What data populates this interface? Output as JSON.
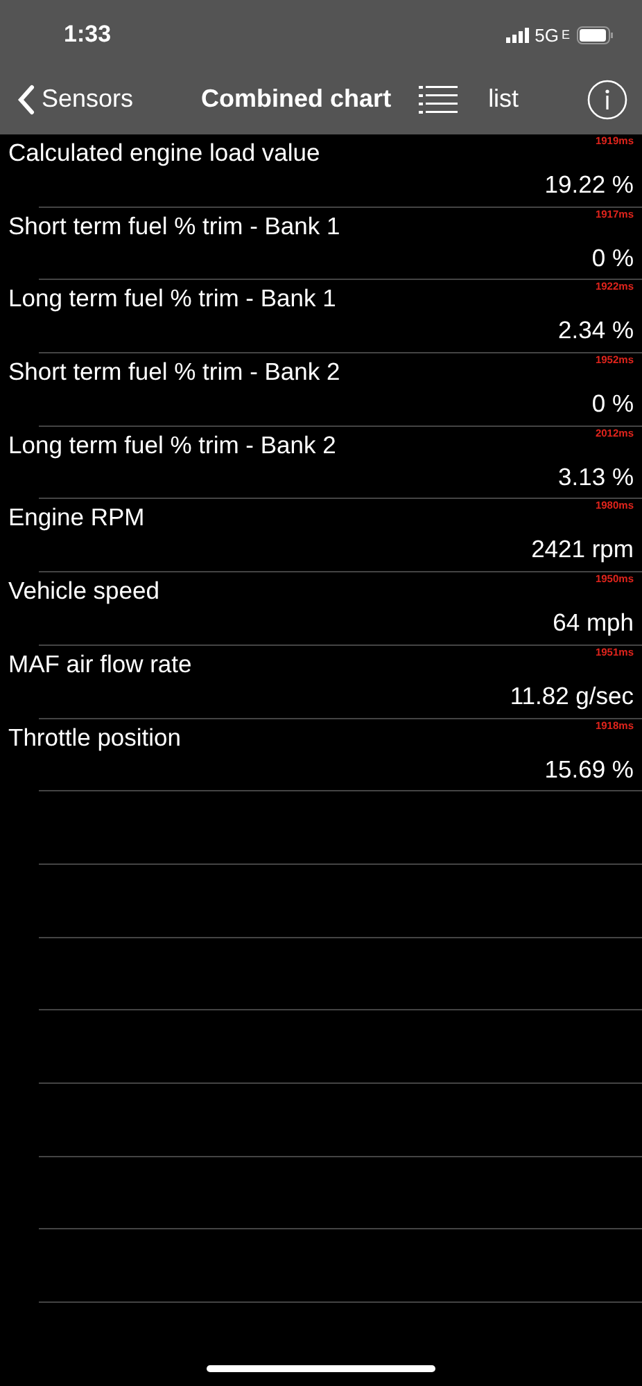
{
  "status_bar": {
    "time": "1:33",
    "network": "5G",
    "network_suffix": "E"
  },
  "nav": {
    "back": "Sensors",
    "title": "Combined chart",
    "mode": "list"
  },
  "sensors": [
    {
      "name": "Calculated engine load value",
      "value": "19.22 %",
      "interval": "1919ms"
    },
    {
      "name": "Short term fuel % trim - Bank 1",
      "value": "0 %",
      "interval": "1917ms"
    },
    {
      "name": "Long term fuel % trim - Bank 1",
      "value": "2.34 %",
      "interval": "1922ms"
    },
    {
      "name": "Short term fuel % trim - Bank 2",
      "value": "0 %",
      "interval": "1952ms"
    },
    {
      "name": "Long term fuel % trim - Bank 2",
      "value": "3.13 %",
      "interval": "2012ms"
    },
    {
      "name": "Engine RPM",
      "value": "2421 rpm",
      "interval": "1980ms"
    },
    {
      "name": "Vehicle speed",
      "value": "64 mph",
      "interval": "1950ms"
    },
    {
      "name": "MAF air flow rate",
      "value": "11.82 g/sec",
      "interval": "1951ms"
    },
    {
      "name": "Throttle position",
      "value": "15.69 %",
      "interval": "1918ms"
    }
  ]
}
